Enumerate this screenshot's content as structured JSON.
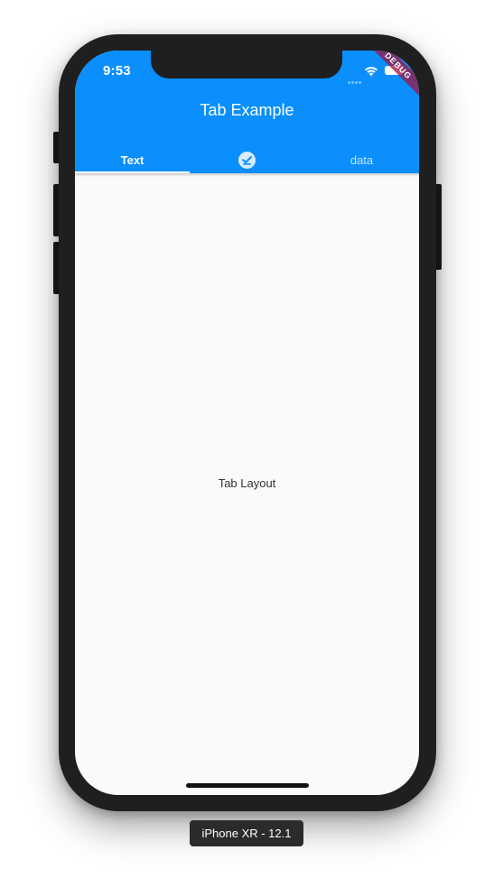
{
  "status_bar": {
    "time": "9:53"
  },
  "debug_banner": "DEBUG",
  "app_bar": {
    "title": "Tab Example"
  },
  "tabs": [
    {
      "label": "Text",
      "selected": true
    },
    {
      "icon": "check-circle-icon",
      "selected": false
    },
    {
      "label": "data",
      "selected": false
    }
  ],
  "body": {
    "text": "Tab Layout"
  },
  "device_label": "iPhone XR - 12.1",
  "colors": {
    "app_bar": "#0a8ffc",
    "body_background": "#fafafa",
    "indicator": "#ffffff"
  }
}
